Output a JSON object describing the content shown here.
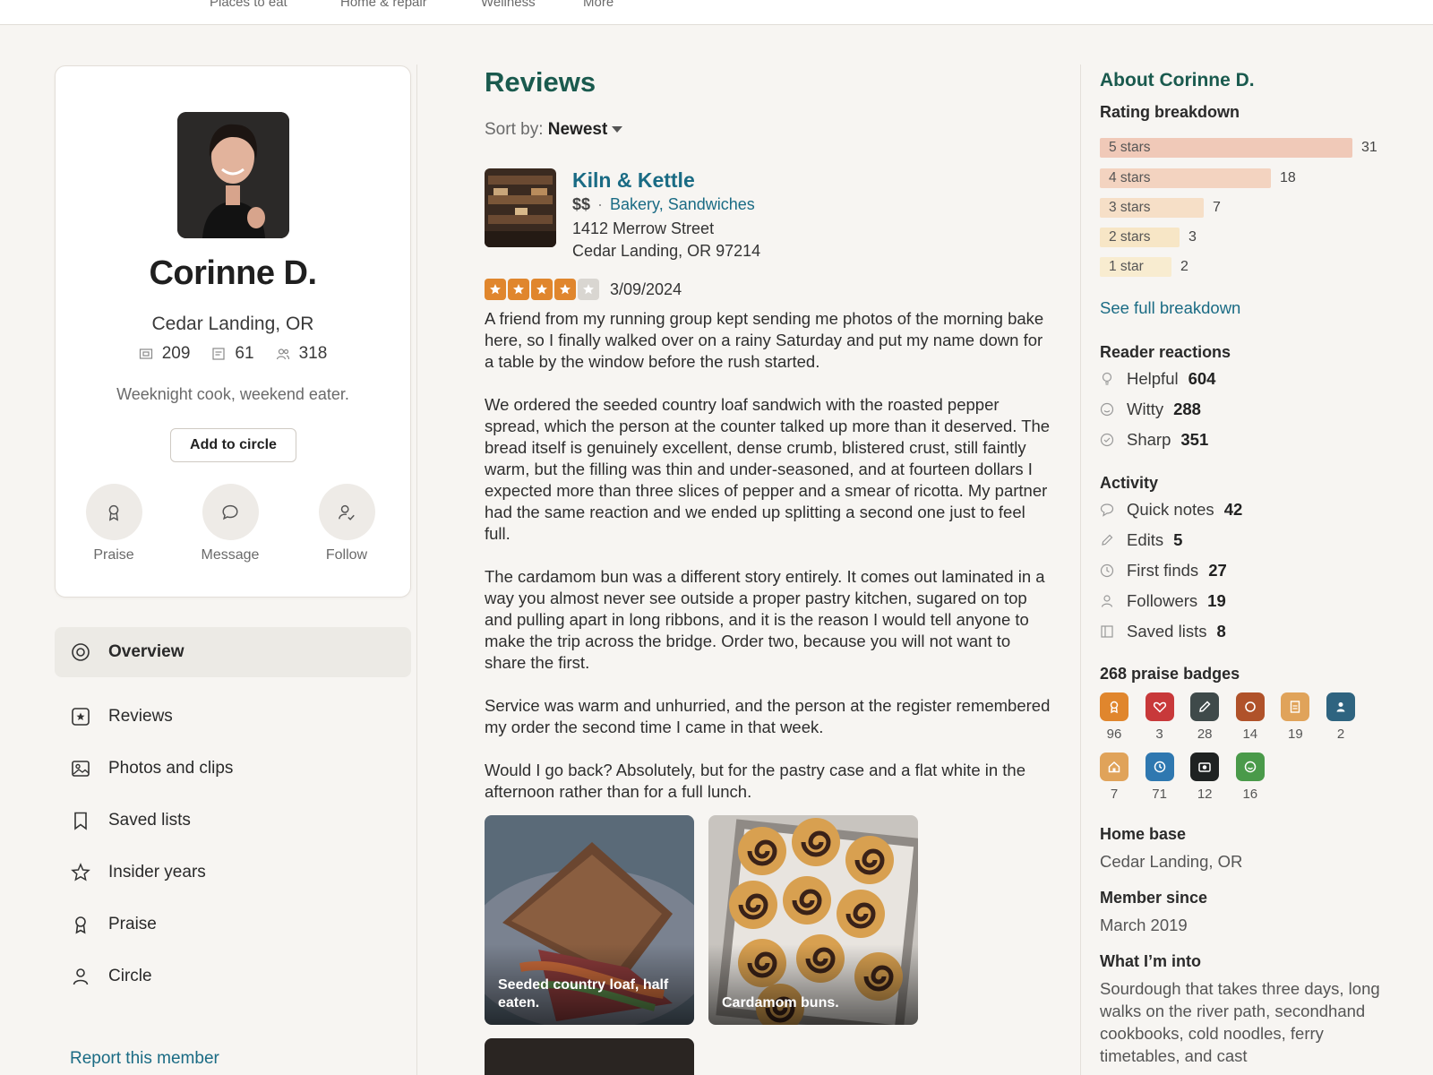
{
  "topnav": [
    "Places to eat",
    "Home & repair",
    "Wellness",
    "More"
  ],
  "profile": {
    "name": "Corinne D.",
    "location": "Cedar Landing, OR",
    "stats": {
      "photos": "209",
      "reviews": "61",
      "friends": "318"
    },
    "tagline": "Weeknight cook, weekend eater.",
    "add_circle": "Add to circle",
    "actions": [
      "Praise",
      "Message",
      "Follow"
    ]
  },
  "nav": [
    "Overview",
    "Reviews",
    "Photos and clips",
    "Saved lists",
    "Insider years",
    "Praise",
    "Circle"
  ],
  "report": "Report this member",
  "reviews": {
    "title": "Reviews",
    "sort_label": "Sort by:",
    "sort_value": "Newest",
    "business": {
      "name": "Kiln & Kettle",
      "price": "$$",
      "categories": "Bakery, Sandwiches",
      "address1": "1412 Merrow Street",
      "address2": "Cedar Landing, OR 97214"
    },
    "rating": 4,
    "date": "3/09/2024",
    "paragraphs": [
      "A friend from my running group kept sending me photos of the morning bake here, so I finally walked over on a rainy Saturday and put my name down for a table by the window before the rush started.",
      "We ordered the seeded country loaf sandwich with the roasted pepper spread, which the person at the counter talked up more than it deserved. The bread itself is genuinely excellent, dense crumb, blistered crust, still faintly warm, but the filling was thin and under-seasoned, and at fourteen dollars I expected more than three slices of pepper and a smear of ricotta. My partner had the same reaction and we ended up splitting a second one just to feel full.",
      "The cardamom bun was a different story entirely. It comes out laminated in a way you almost never see outside a proper pastry kitchen, sugared on top and pulling apart in long ribbons, and it is the reason I would tell anyone to make the trip across the bridge. Order two, because you will not want to share the first.",
      "Service was warm and unhurried, and the person at the register remembered my order the second time I came in that week.",
      "Would I go back? Absolutely, but for the pastry case and a flat white in the afternoon rather than for a full lunch."
    ],
    "photos": [
      "Seeded country loaf, half eaten.",
      "Cardamom buns."
    ]
  },
  "about": {
    "title": "About Corinne D.",
    "rating_title": "Rating breakdown",
    "ratings": [
      {
        "label": "5 stars",
        "count": 31,
        "color": "#f0c9b8"
      },
      {
        "label": "4 stars",
        "count": 18,
        "color": "#f3d3c0"
      },
      {
        "label": "3 stars",
        "count": 7,
        "color": "#f6dfc7"
      },
      {
        "label": "2 stars",
        "count": 3,
        "color": "#f7e6c6"
      },
      {
        "label": "1 star",
        "count": 2,
        "color": "#f8ecd0"
      }
    ],
    "full_breakdown": "See full breakdown",
    "reactions_title": "Reader reactions",
    "reactions": [
      {
        "label": "Helpful",
        "value": "604"
      },
      {
        "label": "Witty",
        "value": "288"
      },
      {
        "label": "Sharp",
        "value": "351"
      }
    ],
    "activity_title": "Activity",
    "activity": [
      {
        "label": "Quick notes",
        "value": "42"
      },
      {
        "label": "Edits",
        "value": "5"
      },
      {
        "label": "First finds",
        "value": "27"
      },
      {
        "label": "Followers",
        "value": "19"
      },
      {
        "label": "Saved lists",
        "value": "8"
      }
    ],
    "badges_title": "268 praise badges",
    "badges": [
      {
        "count": "96",
        "color": "#e0862d",
        "icon": "ribbon-icon"
      },
      {
        "count": "3",
        "color": "#c8393a",
        "icon": "heart-icon"
      },
      {
        "count": "28",
        "color": "#3f4a4a",
        "icon": "pencil-icon"
      },
      {
        "count": "14",
        "color": "#b0522a",
        "icon": "circle-icon"
      },
      {
        "count": "19",
        "color": "#e0a35a",
        "icon": "document-icon"
      },
      {
        "count": "2",
        "color": "#2f6480",
        "icon": "person-icon"
      },
      {
        "count": "7",
        "color": "#e0a35a",
        "icon": "house-icon"
      },
      {
        "count": "71",
        "color": "#2f78b0",
        "icon": "clock-icon"
      },
      {
        "count": "12",
        "color": "#1f2222",
        "icon": "camera-icon"
      },
      {
        "count": "16",
        "color": "#4a9a4a",
        "icon": "smile-icon"
      }
    ],
    "home_title": "Home base",
    "home_value": "Cedar Landing, OR",
    "since_title": "Member since",
    "since_value": "March 2019",
    "into_title": "What I’m into",
    "into_value": "Sourdough that takes three days, long walks on the river path, secondhand cookbooks, cold noodles, ferry timetables, and cast"
  }
}
